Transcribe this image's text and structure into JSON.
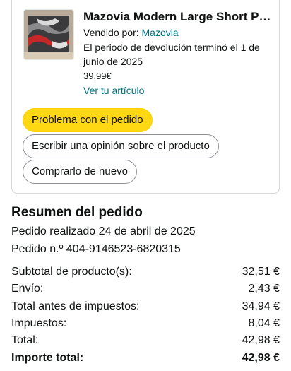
{
  "product": {
    "title": "Mazovia Modern Large Short Pil…",
    "seller_label": "Vendido por:",
    "seller_name": "Mazovia",
    "return_notice_line1": "El periodo de devolución terminó el 1 de",
    "return_notice_line2": "junio de 2025",
    "price": "39,99€",
    "view_item_link": "Ver tu artículo"
  },
  "actions": {
    "problem_button": "Problema con el pedido",
    "review_button": "Escribir una opinión sobre el producto",
    "buy_again_button": "Comprarlo de nuevo"
  },
  "summary": {
    "heading": "Resumen del pedido",
    "order_date": "Pedido realizado 24 de abril de 2025",
    "order_number": "Pedido n.º 404-9146523-6820315",
    "rows": [
      {
        "label": "Subtotal de producto(s):",
        "value": "32,51 €"
      },
      {
        "label": "Envío:",
        "value": "2,43 €"
      },
      {
        "label": "Total antes de impuestos:",
        "value": "34,94 €"
      },
      {
        "label": "Impuestos:",
        "value": "8,04 €"
      },
      {
        "label": "Total:",
        "value": "42,98 €"
      },
      {
        "label": "Importe total:",
        "value": "42,98 €"
      }
    ]
  },
  "colors": {
    "accent_yellow": "#ffd814",
    "link_teal": "#007185",
    "text": "#0f1111"
  }
}
